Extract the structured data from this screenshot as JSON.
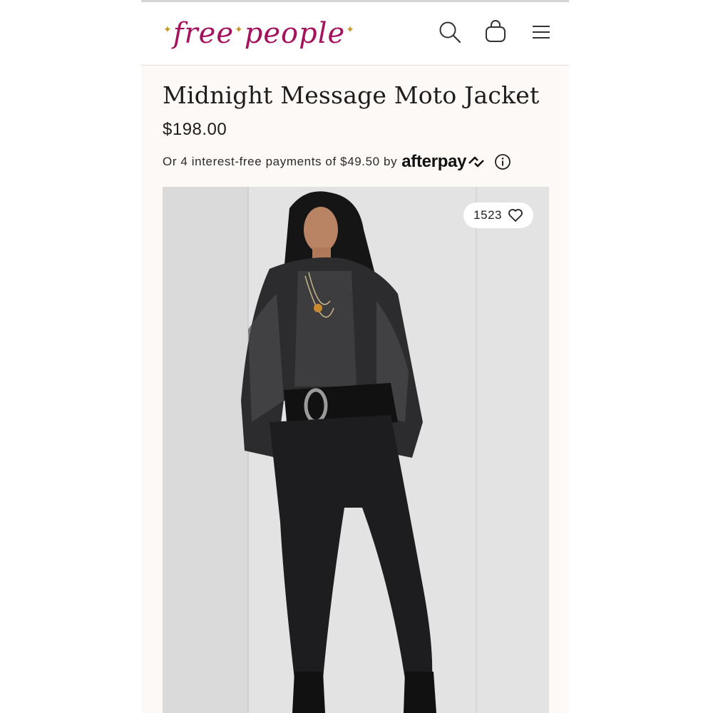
{
  "brand": {
    "logo_text_1": "free",
    "logo_text_2": "people",
    "color": "#a4125e",
    "star_color": "#c79a2e"
  },
  "header": {
    "icons": [
      "search-icon",
      "shopping-bag-icon",
      "hamburger-menu-icon"
    ]
  },
  "product": {
    "title": "Midnight Message Moto Jacket",
    "price": "$198.00",
    "installments_text": "Or 4 interest-free payments of $49.50 by",
    "afterpay_label": "afterpay",
    "info_icon": "info-icon"
  },
  "image": {
    "like_count": "1523",
    "like_icon": "heart-icon"
  }
}
